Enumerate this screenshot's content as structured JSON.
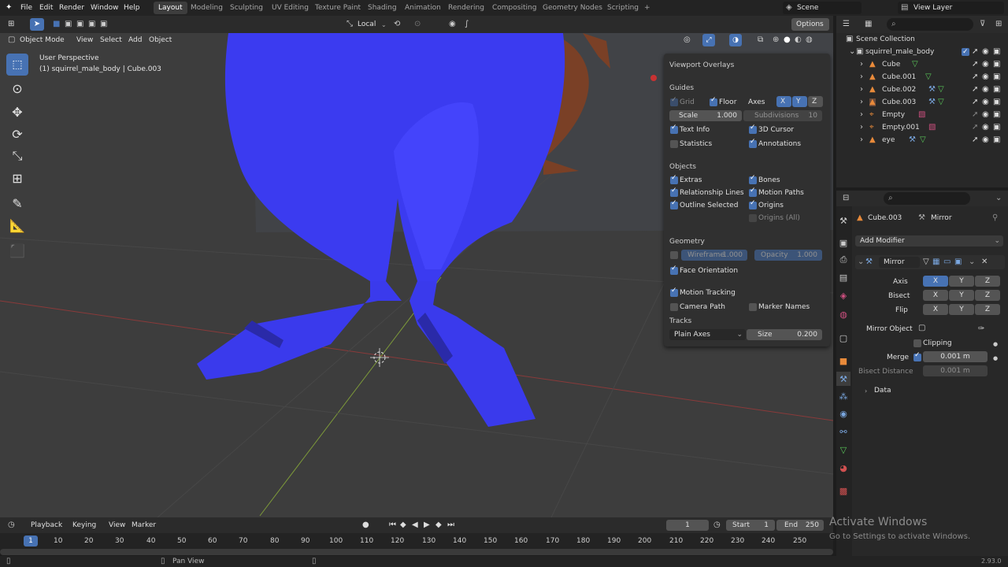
{
  "topbar": {
    "menus": [
      "File",
      "Edit",
      "Render",
      "Window",
      "Help"
    ],
    "workspaces": [
      "Layout",
      "Modeling",
      "Sculpting",
      "UV Editing",
      "Texture Paint",
      "Shading",
      "Animation",
      "Rendering",
      "Compositing",
      "Geometry Nodes",
      "Scripting"
    ],
    "active_workspace": "Layout",
    "add_tab": "+",
    "scene": "Scene",
    "view_layer": "View Layer"
  },
  "viewport_header": {
    "mode": "Object Mode",
    "menus": [
      "View",
      "Select",
      "Add",
      "Object"
    ],
    "orientation": "Local",
    "options": "Options"
  },
  "viewport": {
    "perspective": "User Perspective",
    "object_info": "(1) squirrel_male_body | Cube.003"
  },
  "overlays": {
    "title": "Viewport Overlays",
    "guides_title": "Guides",
    "grid": "Grid",
    "floor": "Floor",
    "axes": "Axes",
    "axis_x": "X",
    "axis_y": "Y",
    "axis_z": "Z",
    "scale_label": "Scale",
    "scale_value": "1.000",
    "subdivisions_label": "Subdivisions",
    "subdivisions_value": "10",
    "text_info": "Text Info",
    "cursor_3d": "3D Cursor",
    "statistics": "Statistics",
    "annotations": "Annotations",
    "objects_title": "Objects",
    "extras": "Extras",
    "bones": "Bones",
    "relationship_lines": "Relationship Lines",
    "motion_paths": "Motion Paths",
    "outline_selected": "Outline Selected",
    "origins": "Origins",
    "origins_all": "Origins (All)",
    "geometry_title": "Geometry",
    "wireframe_label": "Wireframe",
    "wireframe_value": "1.000",
    "opacity_label": "Opacity",
    "opacity_value": "1.000",
    "face_orientation": "Face Orientation",
    "motion_tracking": "Motion Tracking",
    "camera_path": "Camera Path",
    "marker_names": "Marker Names",
    "tracks_title": "Tracks",
    "tracks_value": "Plain Axes",
    "size_label": "Size",
    "size_value": "0.200"
  },
  "outliner": {
    "collection": "Scene Collection",
    "items": [
      {
        "name": "squirrel_male_body",
        "color": "#d6d6d6"
      },
      {
        "name": "Cube"
      },
      {
        "name": "Cube.001"
      },
      {
        "name": "Cube.002"
      },
      {
        "name": "Cube.003"
      },
      {
        "name": "Empty"
      },
      {
        "name": "Empty.001"
      },
      {
        "name": "eye"
      }
    ]
  },
  "properties": {
    "object": "Cube.003",
    "modifier_tab": "Mirror",
    "add_modifier": "Add Modifier",
    "modifier_name": "Mirror",
    "axis_label": "Axis",
    "bisect_label": "Bisect",
    "flip_label": "Flip",
    "x": "X",
    "y": "Y",
    "z": "Z",
    "mirror_object_label": "Mirror Object",
    "clipping": "Clipping",
    "merge_label": "Merge",
    "merge_value": "0.001 m",
    "bisect_distance_label": "Bisect Distance",
    "bisect_distance_value": "0.001 m",
    "data": "Data"
  },
  "timeline": {
    "menus": [
      "Playback",
      "Keying",
      "View",
      "Marker"
    ],
    "current_frame": "1",
    "start_label": "Start",
    "start_value": "1",
    "end_label": "End",
    "end_value": "250",
    "ticks": [
      "10",
      "20",
      "30",
      "40",
      "50",
      "60",
      "70",
      "80",
      "90",
      "100",
      "110",
      "120",
      "130",
      "140",
      "150",
      "160",
      "170",
      "180",
      "190",
      "200",
      "210",
      "220",
      "230",
      "240",
      "250"
    ],
    "playhead": "1"
  },
  "statusbar": {
    "hint": "Pan View",
    "version": "2.93.0"
  },
  "watermark": {
    "title": "Activate Windows",
    "subtitle": "Go to Settings to activate Windows."
  },
  "colors": {
    "accent": "#4772b3",
    "mesh": "#3a3ae8",
    "active_tab": "#3d3d3d"
  }
}
